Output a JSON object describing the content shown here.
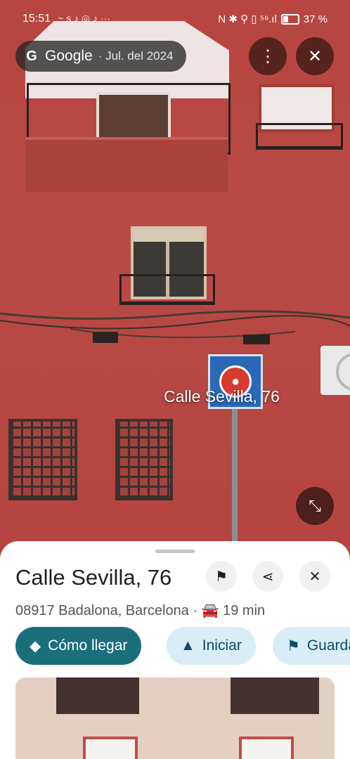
{
  "status": {
    "time": "15:51",
    "left_icons": "~ s ♪ ◎ ♪ ···",
    "right_icons": "N ✱ ⚲ ▯ ⁵⁶.ıl",
    "battery": "37 %"
  },
  "streetview": {
    "source_label": "Google",
    "date": "· Jul. del 2024",
    "menu_icon": "more-vert-icon",
    "close_icon": "close-icon",
    "location_label": "Calle Sevilla, 76",
    "collapse_icon": "collapse-icon"
  },
  "sheet": {
    "title": "Calle Sevilla, 76",
    "address": "08917 Badalona, Barcelona",
    "travel_time": "19 min",
    "actions": {
      "directions": "Cómo llegar",
      "start": "Iniciar",
      "save": "Guardar"
    }
  },
  "colors": {
    "primary_button": "#1b6f7c",
    "secondary_button": "#d8edf5",
    "wall": "#b8453f",
    "pin": "#d93a2f",
    "sign": "#2a68b8"
  }
}
